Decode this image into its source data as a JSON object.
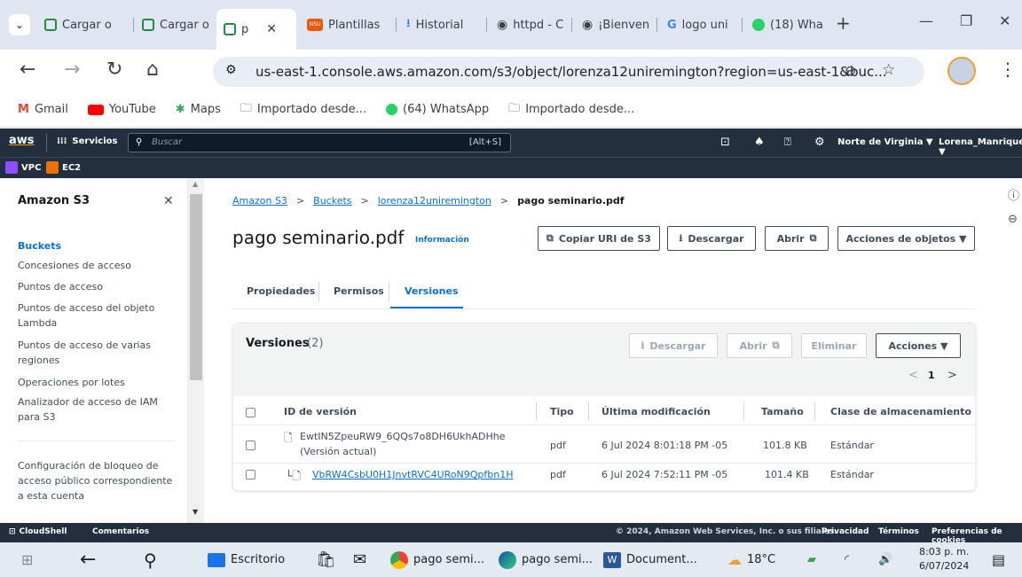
{
  "browser": {
    "tabs": [
      {
        "label": "Cargar o",
        "color": "#1e8e3e"
      },
      {
        "label": "Cargar o",
        "color": "#1e8e3e"
      },
      {
        "label": "p",
        "color": "#1e8e3e"
      },
      {
        "label": "Plantillas",
        "color": "#e8590c",
        "badge": "NSU"
      },
      {
        "label": "Historial",
        "color": "#1a73e8"
      },
      {
        "label": "httpd - C",
        "color": "#202124"
      },
      {
        "label": "¡Bienven",
        "color": "#202124"
      },
      {
        "label": "logo uni",
        "color": "#4285f4"
      },
      {
        "label": "(18) Wha",
        "color": "#25d366"
      }
    ],
    "url": "us-east-1.console.aws.amazon.com/s3/object/lorenza12uniremington?region=us-east-1&buc...",
    "bookmarks": [
      "Gmail",
      "YouTube",
      "Maps",
      "Importado desde...",
      "(64) WhatsApp",
      "Importado desde..."
    ]
  },
  "aws": {
    "logo": "aws",
    "services_label": "Servicios",
    "search_placeholder": "Buscar",
    "search_shortcut": "[Alt+S]",
    "region": "Norte de Virginia ▼",
    "user": "Lorena_Manrique ▼",
    "favorites": [
      "VPC",
      "EC2"
    ]
  },
  "sidebar": {
    "title": "Amazon S3",
    "items": [
      "Buckets",
      "Concesiones de acceso",
      "Puntos de acceso",
      "Puntos de acceso del objeto Lambda",
      "Puntos de acceso de varias regiones",
      "Operaciones por lotes",
      "Analizador de acceso de IAM para S3",
      "Configuración de bloqueo de acceso público correspondiente a esta cuenta"
    ]
  },
  "breadcrumb": [
    "Amazon S3",
    "Buckets",
    "lorenza12uniremington",
    "pago seminario.pdf"
  ],
  "object": {
    "title": "pago seminario.pdf",
    "info_link": "Información",
    "buttons": {
      "copy_uri": "Copiar URI de S3",
      "download": "Descargar",
      "open": "Abrir",
      "actions": "Acciones de objetos ▼"
    }
  },
  "tabs": [
    "Propiedades",
    "Permisos",
    "Versiones"
  ],
  "versions": {
    "title": "Versiones",
    "count": "(2)",
    "buttons": {
      "download": "Descargar",
      "open": "Abrir",
      "delete": "Eliminar",
      "actions": "Acciones ▼"
    },
    "page": "1",
    "columns": [
      "ID de versión",
      "Tipo",
      "Última modificación",
      "Tamaño",
      "Clase de almacenamiento"
    ],
    "rows": [
      {
        "id": "EwtIN5ZpeuRW9_6QQs7o8DH6UkhADHhe",
        "sub": "(Versión actual)",
        "type": "pdf",
        "modified": "6 Jul 2024 8:01:18 PM -05",
        "size": "101.8 KB",
        "class": "Estándar"
      },
      {
        "id": "VbRW4CsbU0H1JnvtRVC4URoN9Qpfbn1H",
        "sub": "",
        "type": "pdf",
        "modified": "6 Jul 2024 7:52:11 PM -05",
        "size": "101.4 KB",
        "class": "Estándar"
      }
    ]
  },
  "footer": {
    "cloudshell": "CloudShell",
    "feedback": "Comentarios",
    "copyright": "© 2024, Amazon Web Services, Inc. o sus filiales.",
    "links": [
      "Privacidad",
      "Términos",
      "Preferencias de cookies"
    ]
  },
  "taskbar": {
    "items": [
      "Escritorio",
      "pago semi...",
      "pago semi...",
      "Document..."
    ],
    "weather": "18°C",
    "time": "8:03 p. m.",
    "date": "6/07/2024"
  }
}
